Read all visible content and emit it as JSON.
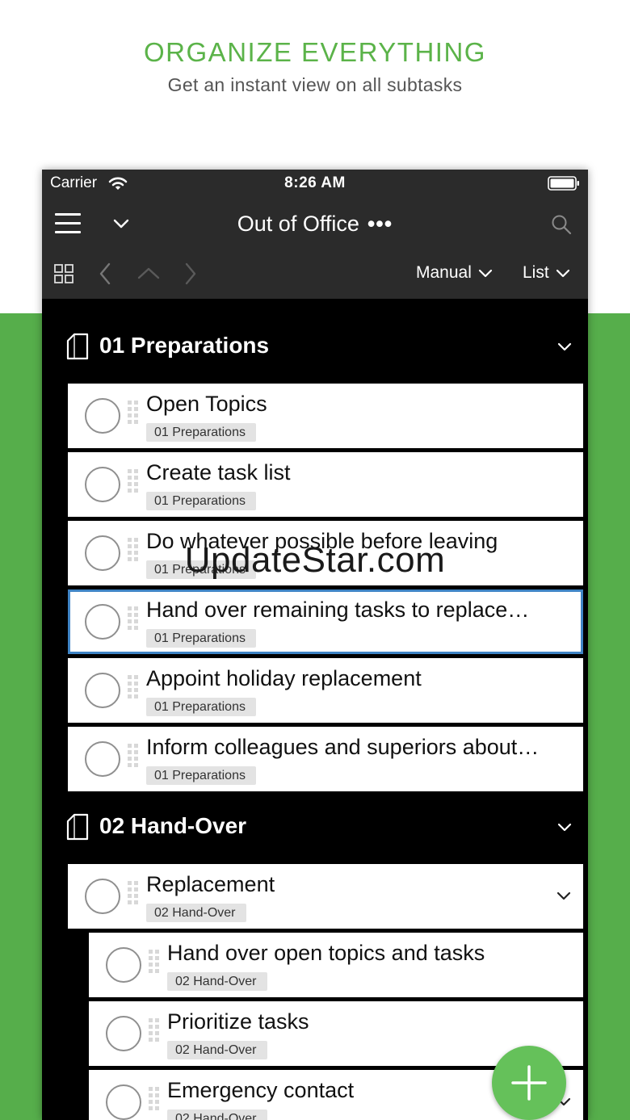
{
  "promo": {
    "headline": "ORGANIZE EVERYTHING",
    "subheadline": "Get an instant view on all subtasks"
  },
  "status_bar": {
    "carrier": "Carrier",
    "time": "8:26 AM"
  },
  "nav": {
    "title": "Out of Office",
    "more": "•••"
  },
  "toolbar": {
    "sort_label": "Manual",
    "view_label": "List"
  },
  "groups": [
    {
      "title": "01 Preparations",
      "tasks": [
        {
          "title": "Open Topics",
          "tag": "01 Preparations"
        },
        {
          "title": "Create task list",
          "tag": "01 Preparations"
        },
        {
          "title": "Do whatever possible before leaving",
          "tag": "01 Preparations"
        },
        {
          "title": "Hand over remaining tasks to replace…",
          "tag": "01 Preparations",
          "selected": true
        },
        {
          "title": "Appoint holiday replacement",
          "tag": "01 Preparations"
        },
        {
          "title": "Inform colleagues and superiors about…",
          "tag": "01 Preparations"
        }
      ]
    },
    {
      "title": "02 Hand-Over",
      "tasks": [
        {
          "title": "Replacement",
          "tag": "02 Hand-Over",
          "expandable": true
        },
        {
          "title": "Hand over open topics and tasks",
          "tag": "02 Hand-Over"
        },
        {
          "title": "Prioritize tasks",
          "tag": "02 Hand-Over"
        },
        {
          "title": "Emergency contact",
          "tag": "02 Hand-Over",
          "expandable": true
        }
      ]
    }
  ],
  "watermark": "UpdateStar.com",
  "colors": {
    "brand_green": "#56ae4b",
    "headline_green": "#5bb349",
    "fab_green": "#65c15a",
    "selection_blue": "#3f84c5",
    "bar_dark": "#2b2b2b"
  },
  "icons": [
    "wifi-icon",
    "battery-icon",
    "menu-icon",
    "chevron-down-icon",
    "search-icon",
    "grid-icon",
    "back-arrow-icon",
    "up-arrow-icon",
    "forward-arrow-icon",
    "notebook-icon",
    "drag-handle-icon",
    "plus-icon"
  ]
}
